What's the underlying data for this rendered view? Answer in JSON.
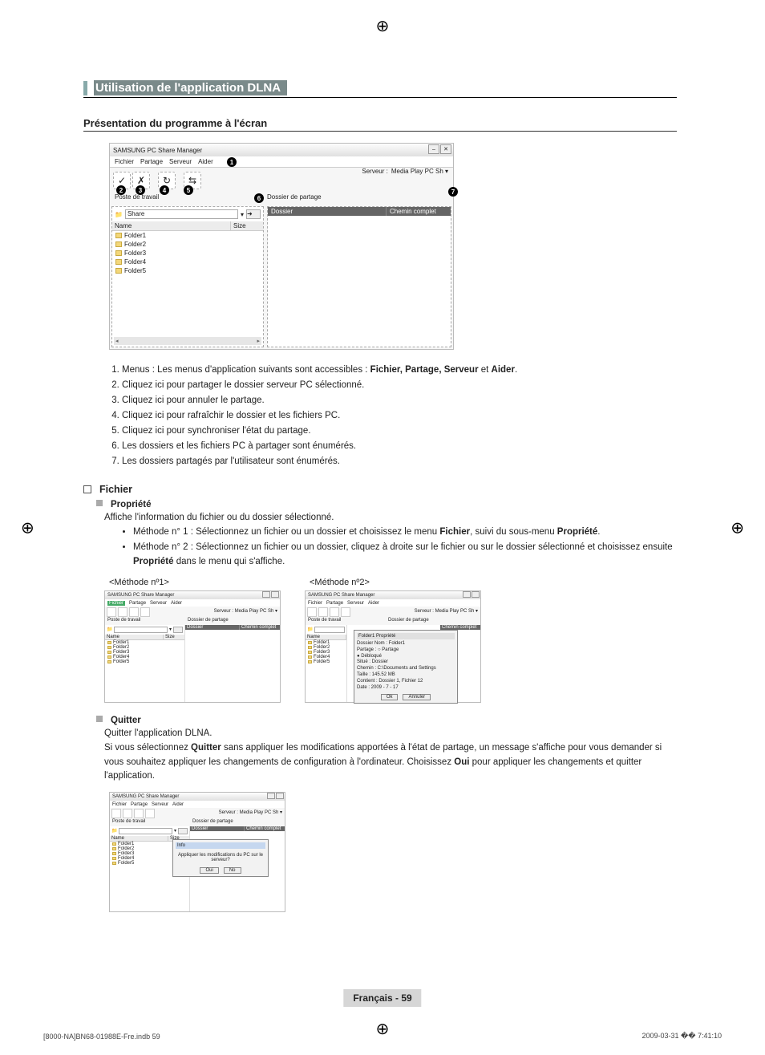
{
  "title": "Utilisation de l'application DLNA",
  "subtitle": "Présentation du programme à l'écran",
  "main_shot": {
    "app_title": "SAMSUNG PC Share Manager",
    "menu": [
      "Fichier",
      "Partage",
      "Serveur",
      "Aider"
    ],
    "server_label": "Serveur :",
    "server_value": "Media Play PC Sh ▾",
    "left_section_label": "Poste de travail",
    "right_section_label": "Dossier de partage",
    "path_label": "Share",
    "list_headers": {
      "name": "Name",
      "size": "Size"
    },
    "folders": [
      "Folder1",
      "Folder2",
      "Folder3",
      "Folder4",
      "Folder5"
    ],
    "right_headers": {
      "folder": "Dossier",
      "path": "Chemin complet"
    }
  },
  "callouts": [
    "1",
    "2",
    "3",
    "4",
    "5",
    "6",
    "7"
  ],
  "toolbar_icons": [
    "share",
    "unshare",
    "refresh",
    "sync"
  ],
  "descriptions": [
    "Menus : Les menus d'application suivants sont accessibles : ",
    "Cliquez ici pour partager le dossier serveur PC sélectionné.",
    "Cliquez ici pour annuler le partage.",
    "Cliquez ici pour rafraîchir le dossier et les fichiers PC.",
    "Cliquez ici pour synchroniser l'état du partage.",
    "Les dossiers et les fichiers PC à partager sont énumérés.",
    "Les dossiers partagés par l'utilisateur sont énumérés."
  ],
  "desc1_bold": "Fichier, Partage, Serveur",
  "desc1_and": " et ",
  "desc1_bold2": "Aider",
  "sections": {
    "fichier": "Fichier",
    "propriete": "Propriété",
    "propriete_text": "Affiche l'information du fichier ou du dossier sélectionné.",
    "method1_pre": "Méthode n° 1 : Sélectionnez un fichier ou un dossier et choisissez le menu ",
    "method1_b1": "Fichier",
    "method1_mid": ", suivi du sous-menu ",
    "method1_b2": "Propriété",
    "method2_pre": "Méthode n° 2 : Sélectionnez un fichier ou un dossier, cliquez à droite sur le fichier ou sur le dossier sélectionné et choisissez ensuite ",
    "method2_b": "Propriété",
    "method2_post": " dans le menu qui s'affiche.",
    "method1_caption": "<Méthode nº1>",
    "method2_caption": "<Méthode nº2>",
    "quitter": "Quitter",
    "quitter_text1": "Quitter l'application DLNA.",
    "quitter_pre": "Si vous sélectionnez ",
    "quitter_b1": "Quitter",
    "quitter_mid": " sans appliquer les modifications apportées à l'état de partage, un message s'affiche pour vous demander si vous souhaitez appliquer les changements de configuration à l'ordinateur. Choisissez ",
    "quitter_b2": "Oui",
    "quitter_post": " pour appliquer les changements et quitter l'application."
  },
  "mini_shot": {
    "app_title": "SAMSUNG PC Share Manager",
    "menu": [
      "Fichier",
      "Partage",
      "Serveur",
      "Aider"
    ],
    "server_label": "Serveur :",
    "server_value": "Media Play PC Sh ▾",
    "left_label": "Poste de travail",
    "right_label": "Dossier de partage",
    "path_label": "Share",
    "list_headers": {
      "name": "Name",
      "size": "Size"
    },
    "folders": [
      "Folder1",
      "Folder2",
      "Folder3",
      "Folder4",
      "Folder5"
    ],
    "right_headers": {
      "folder": "Dossier",
      "path": "Chemin complet"
    }
  },
  "prop_dialog": {
    "title": "Folder1 Propriété",
    "rows": [
      "Dossier Nom : Folder1",
      "Partage :  ○ Partage",
      "               ● Débloqué",
      "Situé : Dossier",
      "Chemin : C:\\Documents and Settings",
      "Taille : 145.52 MB",
      "Contient : Dossier 1, Fichier 12",
      "Date : 2009 - 7 - 17"
    ],
    "ok": "Ok",
    "cancel": "Annuler"
  },
  "quit_dialog": {
    "title": "Info",
    "text": "Appliquer les modifications du PC sur le serveur?",
    "yes": "Oui",
    "no": "No"
  },
  "footer": "Français - 59",
  "print_left": "[8000-NA]BN68-01988E-Fre.indb   59",
  "print_right": "2009-03-31   �� 7:41:10"
}
